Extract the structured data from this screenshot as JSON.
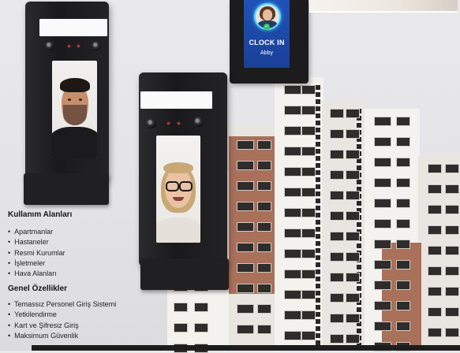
{
  "sections": {
    "usage": {
      "title": "Kullanım Alanları",
      "items": [
        "Apartmanlar",
        "Hastaneler",
        "Resmi Kurumlar",
        "İşletmeler",
        "Hava Alanları"
      ]
    },
    "features": {
      "title": "Genel Özellikler",
      "items": [
        "Temassız Personel Giriş Sistemi",
        "Yetkilendirme",
        "Kart ve Şifresiz Giriş",
        "Maksimum Güvenlik"
      ]
    }
  },
  "clock_screen": {
    "status": "CLOCK IN",
    "name": "Abby",
    "check": "✓"
  },
  "colors": {
    "screen_blue": "#1f52b8",
    "ring_cyan": "#5ad8ff",
    "brick": "#a9705a"
  }
}
